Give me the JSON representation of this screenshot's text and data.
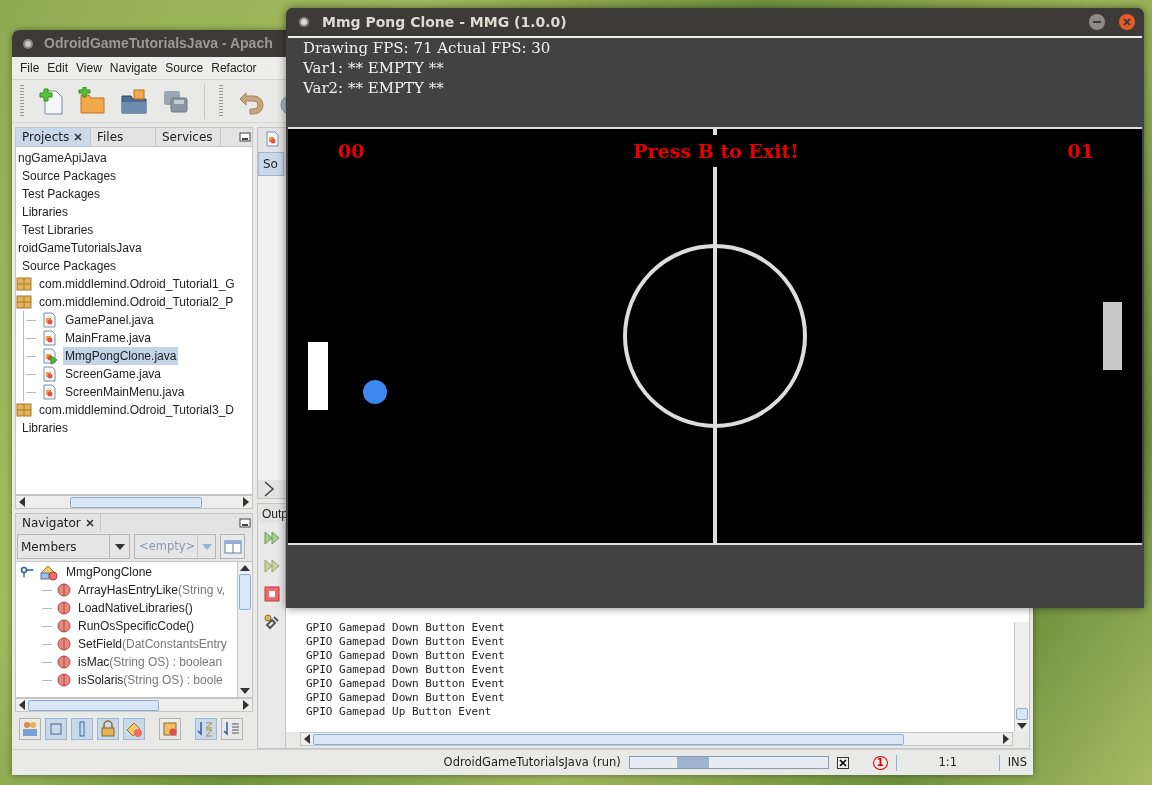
{
  "ide": {
    "title": "OdroidGameTutorialsJava - Apach",
    "menu": [
      {
        "label": "File"
      },
      {
        "label": "Edit"
      },
      {
        "label": "View"
      },
      {
        "label": "Navigate"
      },
      {
        "label": "Source"
      },
      {
        "label": "Refactor"
      }
    ],
    "projects": {
      "tabs": [
        {
          "label": "Projects",
          "selected": true
        },
        {
          "label": "Files",
          "selected": false
        },
        {
          "label": "Services",
          "selected": false
        }
      ],
      "tree": [
        {
          "label": "ngGameApiJava",
          "selected": false,
          "children": [
            {
              "label": "Source Packages",
              "selected": false
            },
            {
              "label": "Test Packages",
              "selected": false
            },
            {
              "label": "Libraries",
              "selected": false
            },
            {
              "label": "Test Libraries",
              "selected": false
            }
          ]
        },
        {
          "label": "roidGameTutorialsJava",
          "selected": false,
          "children": [
            {
              "label": "Source Packages",
              "selected": false,
              "children": [
                {
                  "label": "com.middlemind.Odroid_Tutorial1_G",
                  "kind": "package",
                  "selected": false
                },
                {
                  "label": "com.middlemind.Odroid_Tutorial2_P",
                  "kind": "package",
                  "selected": false,
                  "children": [
                    {
                      "label": "GamePanel.java",
                      "kind": "file",
                      "selected": false
                    },
                    {
                      "label": "MainFrame.java",
                      "kind": "file",
                      "selected": false
                    },
                    {
                      "label": "MmgPongClone.java",
                      "kind": "main_file",
                      "selected": true
                    },
                    {
                      "label": "ScreenGame.java",
                      "kind": "file",
                      "selected": false
                    },
                    {
                      "label": "ScreenMainMenu.java",
                      "kind": "file",
                      "selected": false
                    }
                  ]
                },
                {
                  "label": "com.middlemind.Odroid_Tutorial3_D",
                  "kind": "package",
                  "selected": false
                }
              ]
            },
            {
              "label": "Libraries",
              "selected": false
            }
          ]
        }
      ]
    },
    "editor": {
      "tab": "So"
    },
    "navigator": {
      "title": "Navigator",
      "filter": "Members",
      "placeholder": "<empty>",
      "root": {
        "label": "MmgPongClone",
        "expanded": true
      },
      "members": [
        {
          "name": "ArrayHasEntryLike",
          "params": "(String v,"
        },
        {
          "name": "LoadNativeLibraries()"
        },
        {
          "name": "RunOsSpecificCode()"
        },
        {
          "name": "SetField",
          "params": "(DatConstantsEntry"
        },
        {
          "name": "isMac",
          "params": "(String OS) : boolean"
        },
        {
          "name": "isSolaris",
          "params": "(String OS) : boole"
        }
      ]
    },
    "output": {
      "tab": "Outp",
      "lines": [
        "GPIO Gamepad Down Button Event",
        "GPIO Gamepad Down Button Event",
        "GPIO Gamepad Down Button Event",
        "GPIO Gamepad Down Button Event",
        "GPIO Gamepad Down Button Event",
        "GPIO Gamepad Down Button Event",
        "GPIO Gamepad Up Button Event"
      ]
    },
    "status": {
      "task": "OdroidGameTutorialsJava (run)",
      "running": true,
      "notifications": "1",
      "position": "1:1",
      "mode": "INS"
    }
  },
  "game": {
    "title": "Mmg Pong Clone - MMG (1.0.0)",
    "info": [
      "Drawing FPS: 71 Actual FPS: 30",
      "Var1: ** EMPTY **",
      "Var2: ** EMPTY **"
    ],
    "left_score": "00",
    "message": "Press B to Exit!",
    "right_score": "01"
  }
}
